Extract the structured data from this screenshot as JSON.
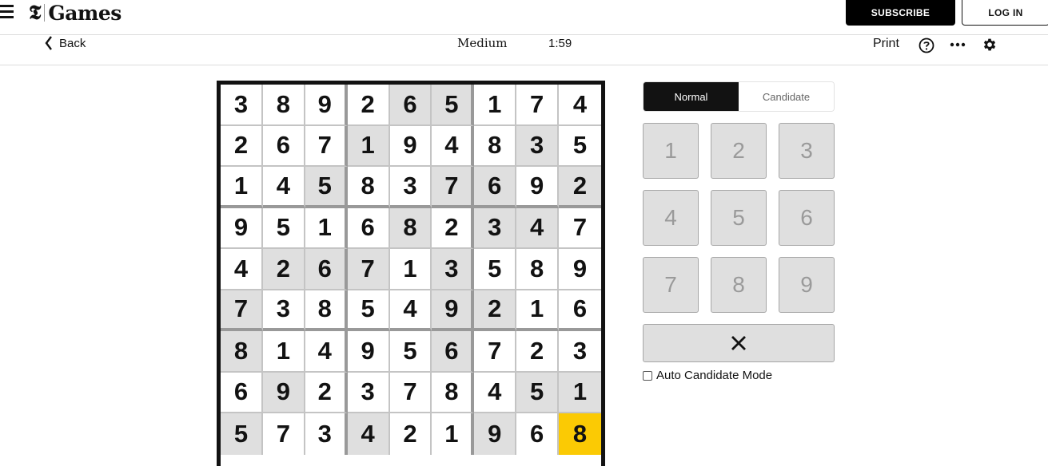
{
  "header": {
    "logo_glyph": "𝕿",
    "logo_text": "Games",
    "subscribe_label": "SUBSCRIBE",
    "login_label": "LOG IN"
  },
  "toolbar": {
    "back_label": "Back",
    "difficulty": "Medium",
    "timer": "1:59",
    "print_label": "Print",
    "icons": [
      "help-icon",
      "more-icon",
      "settings-gear-icon"
    ]
  },
  "board": {
    "rows": [
      [
        "3",
        "8",
        "9",
        "2",
        "6",
        "5",
        "1",
        "7",
        "4"
      ],
      [
        "2",
        "6",
        "7",
        "1",
        "9",
        "4",
        "8",
        "3",
        "5"
      ],
      [
        "1",
        "4",
        "5",
        "8",
        "3",
        "7",
        "6",
        "9",
        "2"
      ],
      [
        "9",
        "5",
        "1",
        "6",
        "8",
        "2",
        "3",
        "4",
        "7"
      ],
      [
        "4",
        "2",
        "6",
        "7",
        "1",
        "3",
        "5",
        "8",
        "9"
      ],
      [
        "7",
        "3",
        "8",
        "5",
        "4",
        "9",
        "2",
        "1",
        "6"
      ],
      [
        "8",
        "1",
        "4",
        "9",
        "5",
        "6",
        "7",
        "2",
        "3"
      ],
      [
        "6",
        "9",
        "2",
        "3",
        "7",
        "8",
        "4",
        "5",
        "1"
      ],
      [
        "5",
        "7",
        "3",
        "4",
        "2",
        "1",
        "9",
        "6",
        "8"
      ]
    ],
    "shaded": [
      [
        0,
        0,
        0,
        0,
        1,
        1,
        0,
        0,
        0
      ],
      [
        0,
        0,
        0,
        1,
        0,
        0,
        0,
        1,
        0
      ],
      [
        0,
        0,
        1,
        0,
        0,
        1,
        1,
        0,
        1
      ],
      [
        0,
        0,
        0,
        0,
        1,
        0,
        1,
        1,
        0
      ],
      [
        0,
        1,
        1,
        1,
        0,
        1,
        0,
        0,
        0
      ],
      [
        1,
        0,
        0,
        0,
        0,
        1,
        1,
        0,
        0
      ],
      [
        1,
        0,
        0,
        0,
        0,
        1,
        0,
        0,
        0
      ],
      [
        0,
        1,
        0,
        0,
        0,
        0,
        0,
        1,
        1
      ],
      [
        1,
        0,
        0,
        1,
        0,
        0,
        1,
        0,
        0
      ]
    ],
    "selected": [
      8,
      8
    ],
    "colors": {
      "selected": "#fbca04",
      "shaded": "#dfdfdf"
    }
  },
  "panel": {
    "modes": [
      {
        "label": "Normal",
        "active": true
      },
      {
        "label": "Candidate",
        "active": false
      }
    ],
    "keys": [
      "1",
      "2",
      "3",
      "4",
      "5",
      "6",
      "7",
      "8",
      "9"
    ],
    "erase_icon": "close-x-icon",
    "auto_candidate_label": "Auto Candidate Mode",
    "auto_candidate_checked": false
  }
}
